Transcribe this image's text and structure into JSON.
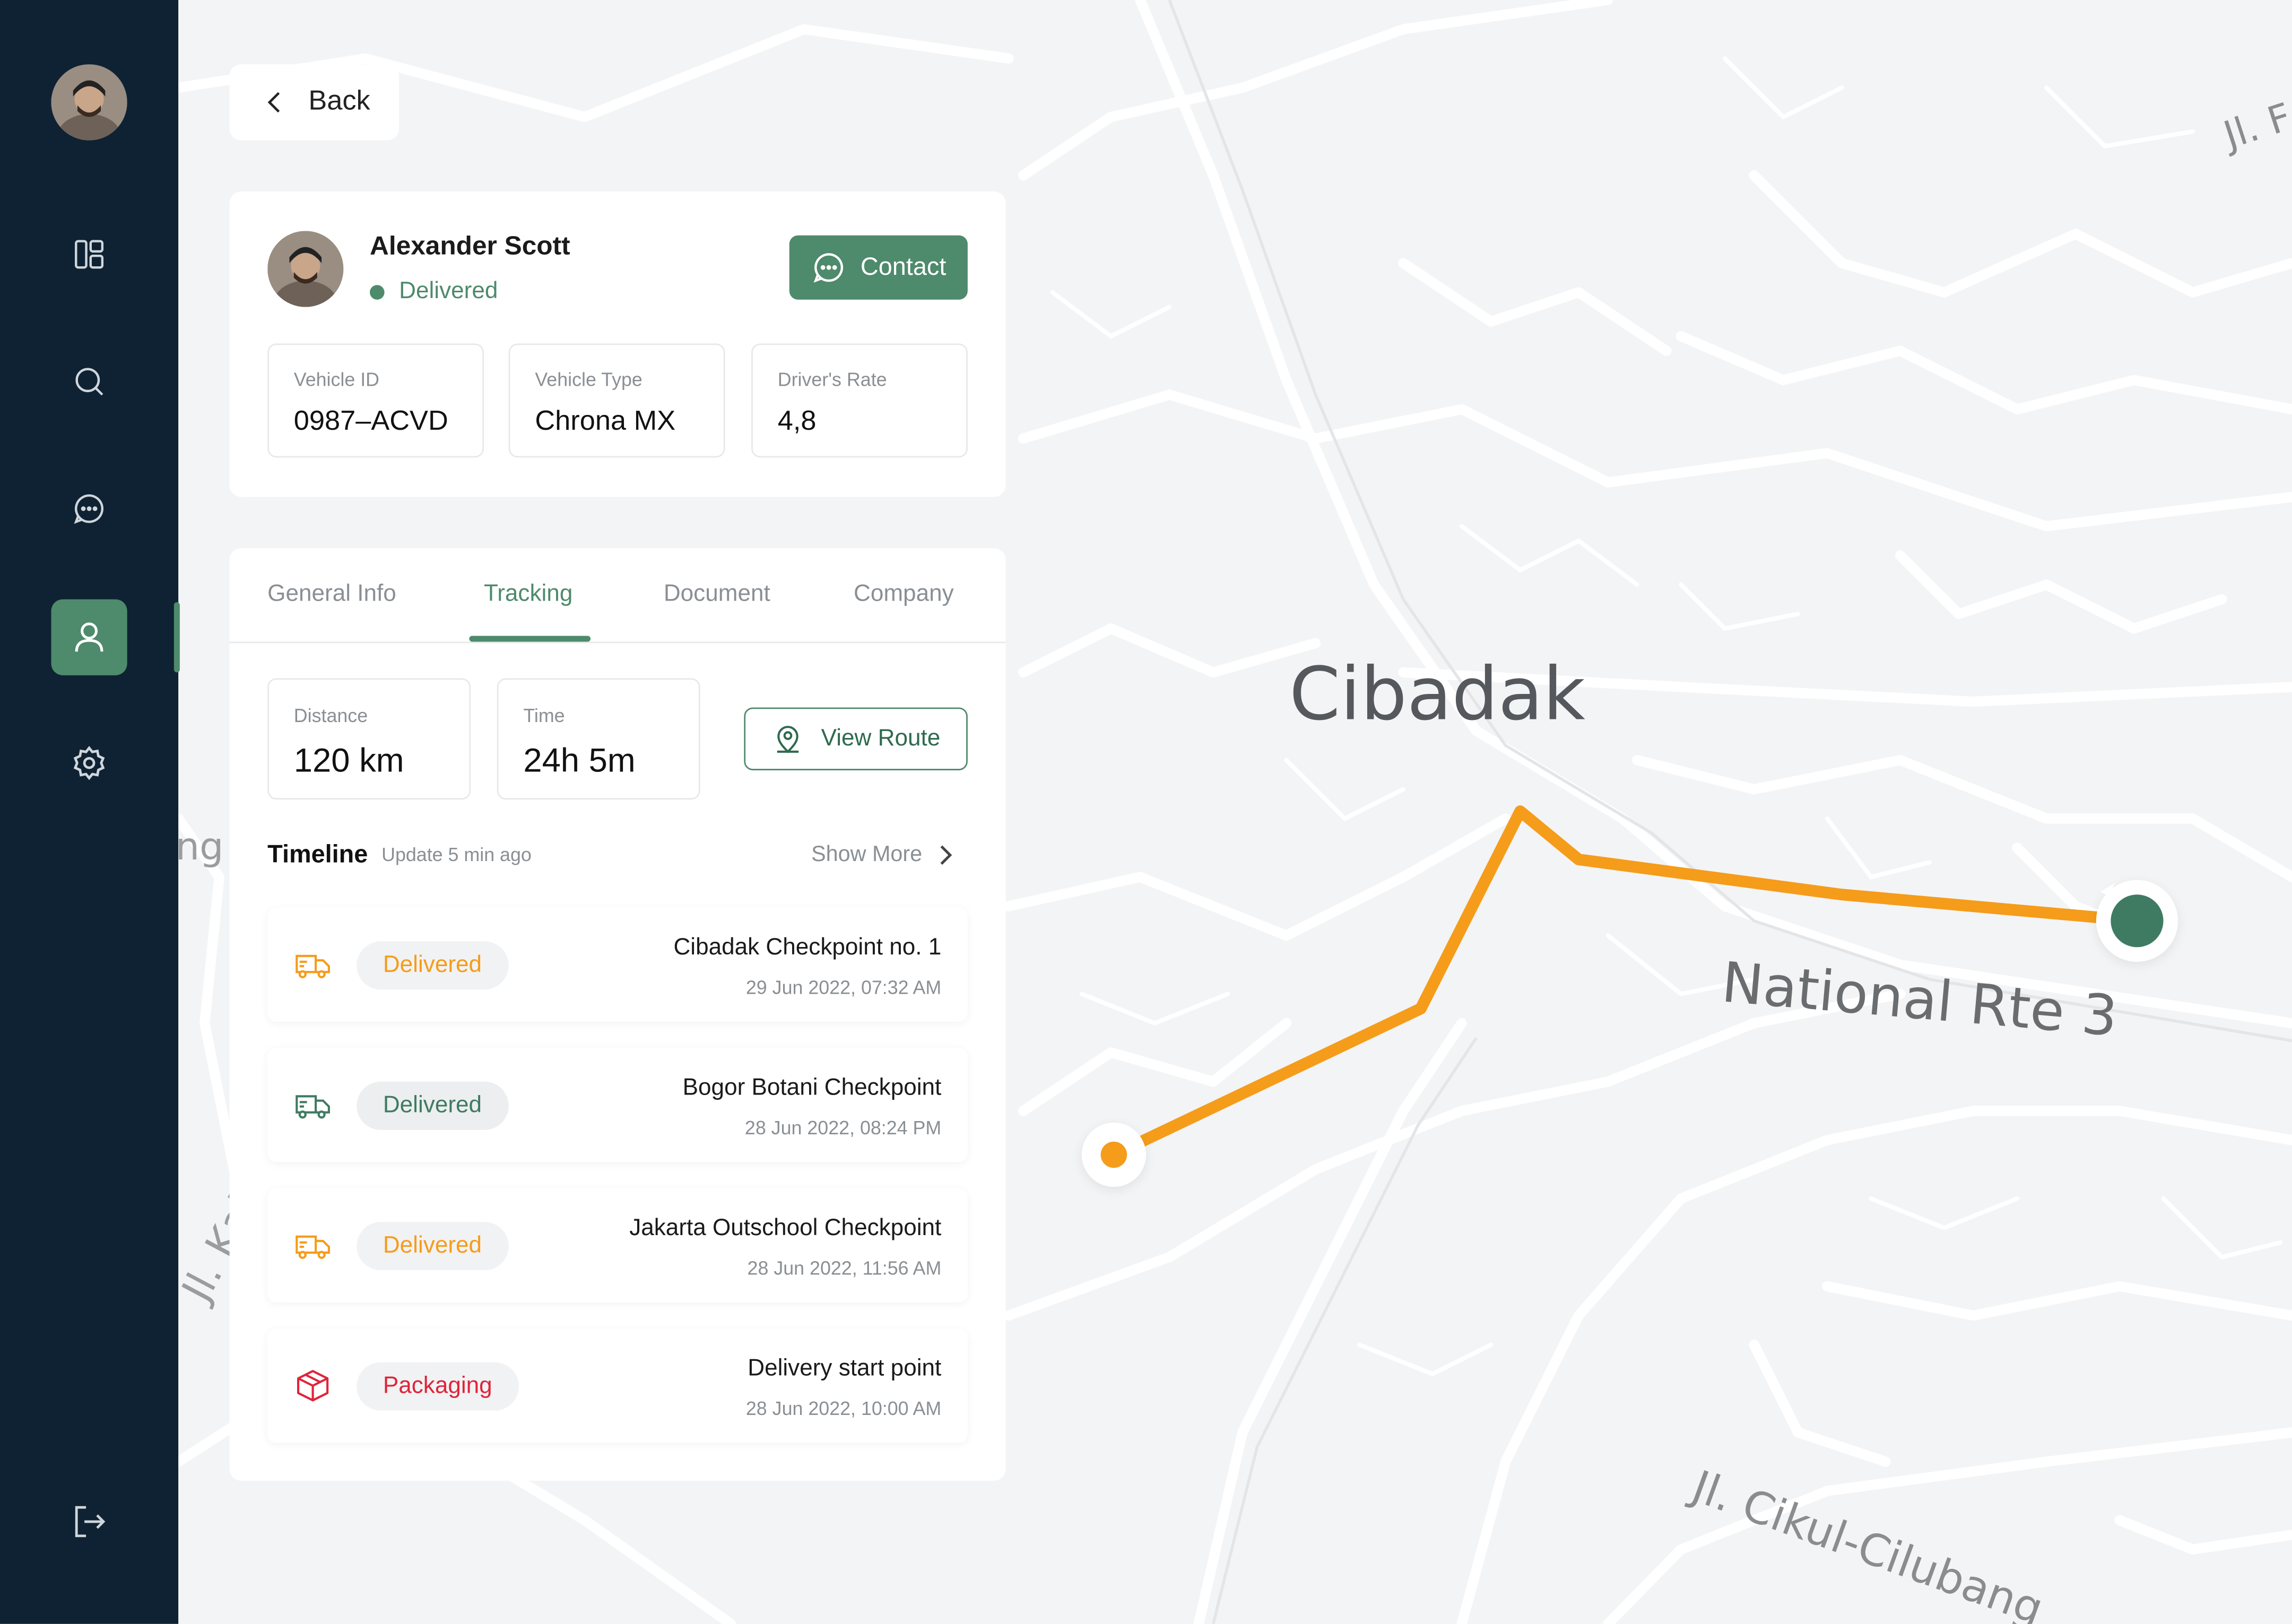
{
  "colors": {
    "sidebar_bg": "#0f2233",
    "accent_green": "#4e8a6c",
    "route_orange": "#f59c1a",
    "packaging_red": "#e0243a"
  },
  "nav": {
    "items": [
      {
        "icon": "dashboard-icon",
        "active": false
      },
      {
        "icon": "search-icon",
        "active": false
      },
      {
        "icon": "chat-icon",
        "active": false
      },
      {
        "icon": "user-icon",
        "active": true
      },
      {
        "icon": "gear-icon",
        "active": false
      }
    ],
    "logout_icon": "logout-icon"
  },
  "back_label": "Back",
  "driver": {
    "name": "Alexander Scott",
    "status": "Delivered",
    "contact_label": "Contact",
    "stats": [
      {
        "label": "Vehicle ID",
        "value": "0987–ACVD"
      },
      {
        "label": "Vehicle Type",
        "value": "Chrona MX"
      },
      {
        "label": "Driver's Rate",
        "value": "4,8"
      }
    ]
  },
  "tabs": [
    {
      "label": "General Info",
      "active": false
    },
    {
      "label": "Tracking",
      "active": true
    },
    {
      "label": "Document",
      "active": false
    },
    {
      "label": "Company",
      "active": false
    }
  ],
  "tracking": {
    "distance_label": "Distance",
    "distance_value": "120 km",
    "time_label": "Time",
    "time_value": "24h 5m",
    "view_route_label": "View Route",
    "timeline_title": "Timeline",
    "timeline_update": "Update 5 min ago",
    "show_more_label": "Show More",
    "events": [
      {
        "status": "Delivered",
        "place": "Cibadak Checkpoint no. 1",
        "date": "29 Jun 2022, 07:32 AM",
        "tone": "orange"
      },
      {
        "status": "Delivered",
        "place": "Bogor Botani Checkpoint",
        "date": "28 Jun 2022, 08:24 PM",
        "tone": "green"
      },
      {
        "status": "Delivered",
        "place": "Jakarta Outschool Checkpoint",
        "date": "28 Jun 2022, 11:56 AM",
        "tone": "orange"
      },
      {
        "status": "Packaging",
        "place": "Delivery start point",
        "date": "28 Jun 2022, 10:00 AM",
        "tone": "red"
      }
    ]
  },
  "map": {
    "labels": {
      "city": "Cibadak",
      "highway": "National Rte 3",
      "road_bottom": "Jl. Cikul-Cilubang",
      "road_top_right": "Jl. F",
      "road_left": "Jl. Kal",
      "fragment_left": "ng"
    }
  }
}
